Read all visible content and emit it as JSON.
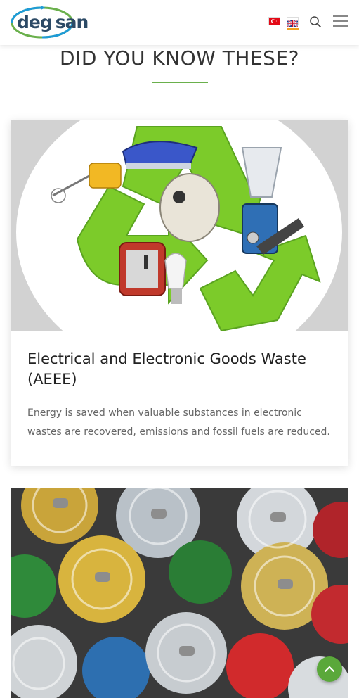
{
  "header": {
    "logo": {
      "left": "deg",
      "right": "san"
    },
    "languages": [
      {
        "code": "tr",
        "name": "Türkçe flag"
      },
      {
        "code": "en",
        "name": "English flag",
        "active": true
      }
    ],
    "icons": {
      "search": "search-icon",
      "menu": "hamburger-menu-icon"
    }
  },
  "section": {
    "title": "DID YOU KNOW THESE?",
    "accent_color": "#6ab04c"
  },
  "cards": [
    {
      "title": "Electrical and Electronic Goods Waste (AEEE)",
      "text": "Energy is saved when valuable substances in electronic wastes are recovered, emissions and fossil fuels are reduced.",
      "image": "recycled-electronics-image"
    },
    {
      "title": "",
      "text": "",
      "image": "crushed-aluminum-cans-image"
    }
  ],
  "scroll_top": {
    "icon": "chevron-up-icon",
    "color": "#5aa83a"
  }
}
